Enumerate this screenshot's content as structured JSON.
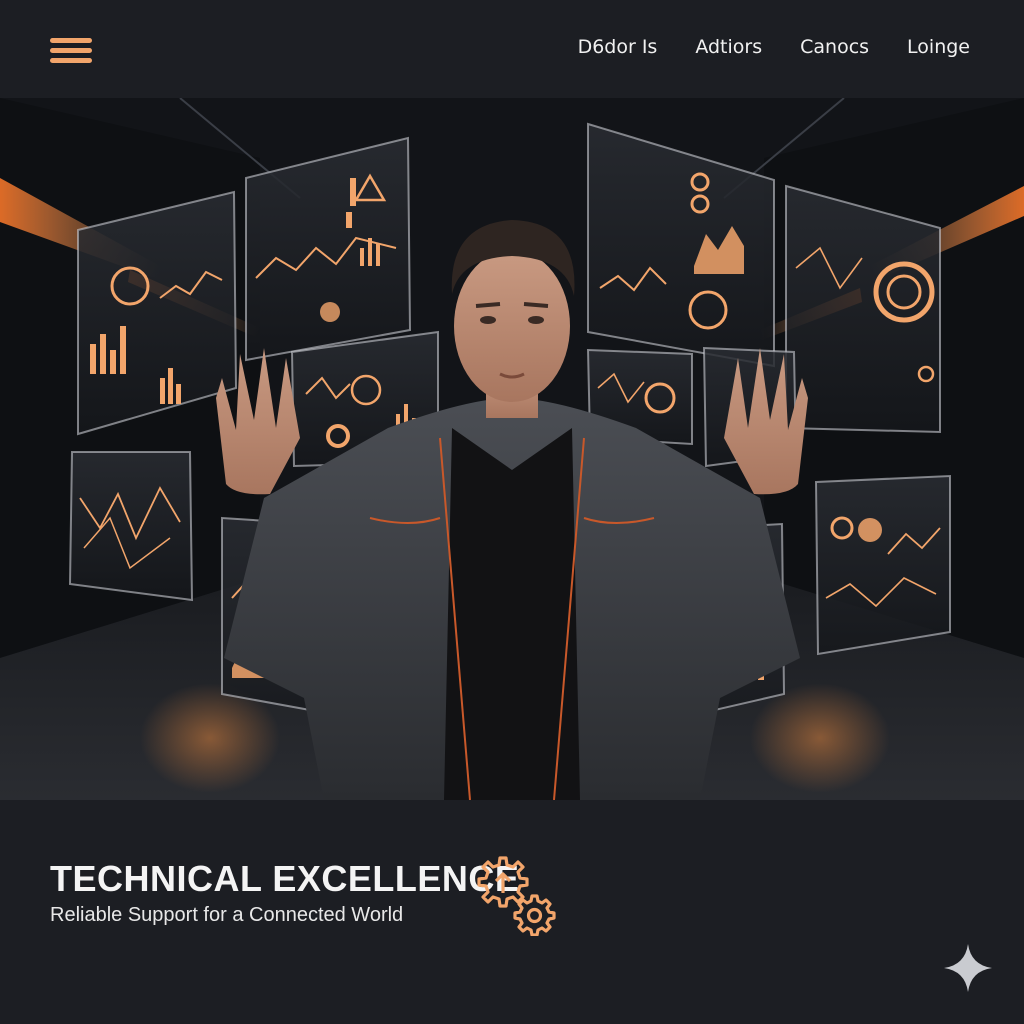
{
  "header": {
    "menu_icon": "hamburger-menu-icon",
    "nav_items": [
      {
        "label": "D6dor Is"
      },
      {
        "label": "Adtiors"
      },
      {
        "label": "Canocs"
      },
      {
        "label": "Loinge"
      }
    ]
  },
  "hero": {
    "image": "man-interacting-with-holographic-dashboards"
  },
  "footer": {
    "title": "TECHNICAL EXCELLENCE",
    "subtitle": "Reliable Support for a Connected World",
    "title_icon": "gears-icon",
    "corner_icon": "sparkle-icon"
  },
  "colors": {
    "accent": "#f2a56b",
    "glow": "#ff8a3d",
    "header_bg": "#1c1e23",
    "text": "#f4f4f4"
  }
}
